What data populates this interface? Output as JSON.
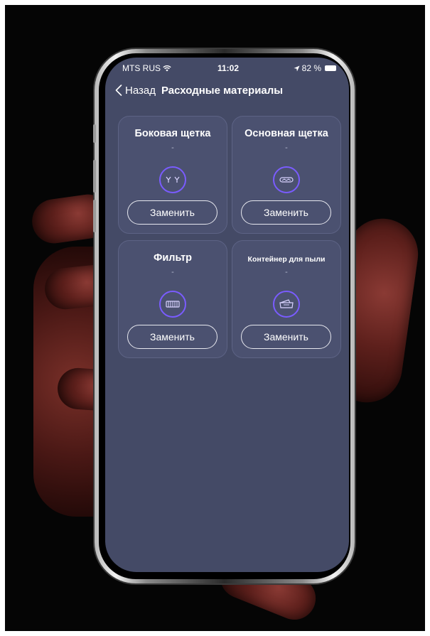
{
  "status_bar": {
    "carrier": "MTS RUS",
    "time": "11:02",
    "battery": "82 %"
  },
  "nav": {
    "back_label": "Назад",
    "title": "Расходные материалы"
  },
  "cards": [
    {
      "title": "Боковая щетка",
      "status": "-",
      "icon": "side-brush-icon",
      "button": "Заменить"
    },
    {
      "title": "Основная щетка",
      "status": "-",
      "icon": "main-brush-icon",
      "button": "Заменить"
    },
    {
      "title": "Фильтр",
      "status": "-",
      "icon": "filter-icon",
      "button": "Заменить"
    },
    {
      "title": "Контейнер для пыли",
      "status": "-",
      "icon": "dust-container-icon",
      "button": "Заменить"
    }
  ],
  "colors": {
    "screen_bg": "#444a66",
    "card_bg": "#4b5170",
    "icon_ring": "#7a5cff",
    "background": "#050505"
  }
}
